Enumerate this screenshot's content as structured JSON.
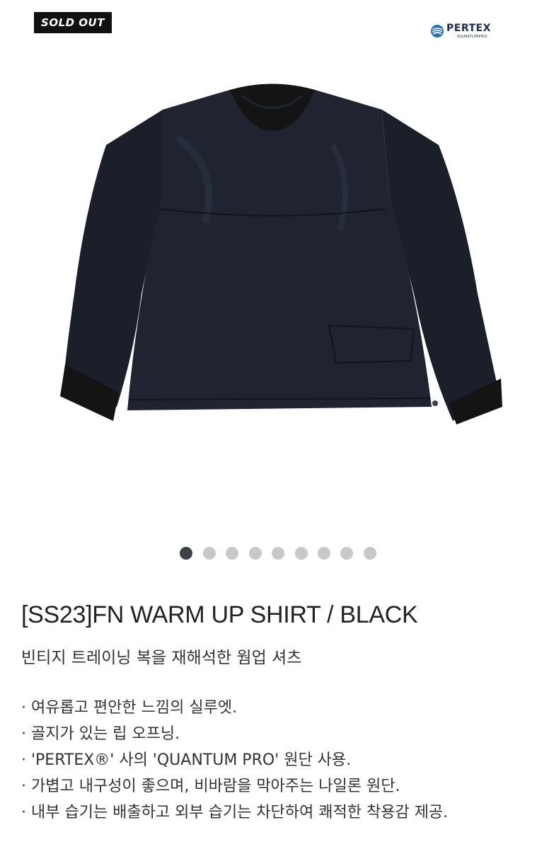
{
  "badge": {
    "label": "SOLD OUT"
  },
  "brand": {
    "name": "PERTEX",
    "sub": "QUANTUMPRO",
    "icon": "pertex-logo-icon"
  },
  "product_image": {
    "icon": "black-warm-up-shirt-image"
  },
  "carousel": {
    "total": 9,
    "active": 1
  },
  "product": {
    "title": "[SS23]FN WARM UP SHIRT / BLACK",
    "subtitle": "빈티지 트레이닝 복을 재해석한 웜업 셔츠",
    "features": [
      "· 여유롭고 편안한 느낌의 실루엣.",
      "· 골지가 있는 립 오프닝.",
      "· 'PERTEX®' 사의 'QUANTUM PRO' 원단 사용.",
      "· 가볍고 내구성이 좋으며, 비바람을 막아주는 나일론 원단.",
      "· 내부 습기는 배출하고 외부 습기는 차단하여 쾌적한 착용감 제공."
    ]
  }
}
